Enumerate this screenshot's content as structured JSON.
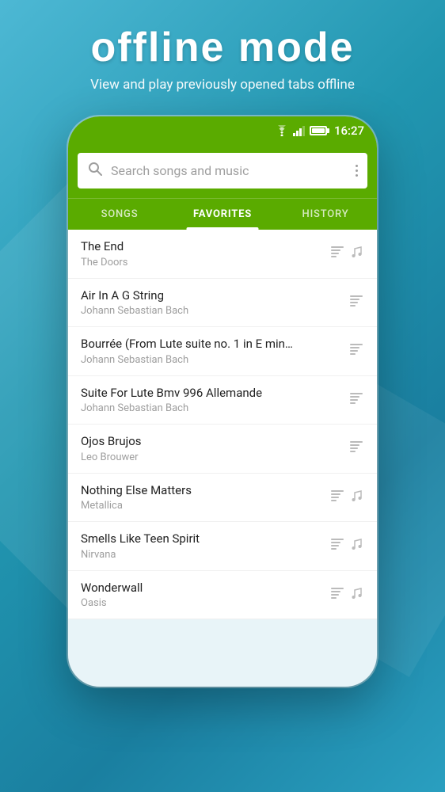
{
  "header": {
    "title": "offline  mode",
    "subtitle": "View and play previously opened tabs offline"
  },
  "status_bar": {
    "time": "16:27"
  },
  "search": {
    "placeholder": "Search songs and music"
  },
  "tabs": [
    {
      "id": "songs",
      "label": "SONGS",
      "active": false
    },
    {
      "id": "favorites",
      "label": "FAVORITES",
      "active": true
    },
    {
      "id": "history",
      "label": "HISTORY",
      "active": false
    }
  ],
  "songs": [
    {
      "title": "The End",
      "artist": "The Doors",
      "has_tabs": true,
      "has_note": true
    },
    {
      "title": "Air In A G String",
      "artist": "Johann Sebastian Bach",
      "has_tabs": true,
      "has_note": false
    },
    {
      "title": "Bourrée (From Lute suite no. 1 in E min…",
      "artist": "Johann Sebastian Bach",
      "has_tabs": true,
      "has_note": false
    },
    {
      "title": "Suite For Lute Bmv 996 Allemande",
      "artist": "Johann Sebastian Bach",
      "has_tabs": true,
      "has_note": false
    },
    {
      "title": "Ojos Brujos",
      "artist": "Leo Brouwer",
      "has_tabs": true,
      "has_note": false
    },
    {
      "title": "Nothing Else Matters",
      "artist": "Metallica",
      "has_tabs": true,
      "has_note": true
    },
    {
      "title": "Smells Like Teen Spirit",
      "artist": "Nirvana",
      "has_tabs": true,
      "has_note": true
    },
    {
      "title": "Wonderwall",
      "artist": "Oasis",
      "has_tabs": true,
      "has_note": true
    }
  ],
  "colors": {
    "accent_green": "#5aab00",
    "background_blue": "#4db8d4",
    "text_dark": "#212121",
    "text_gray": "#9e9e9e"
  }
}
